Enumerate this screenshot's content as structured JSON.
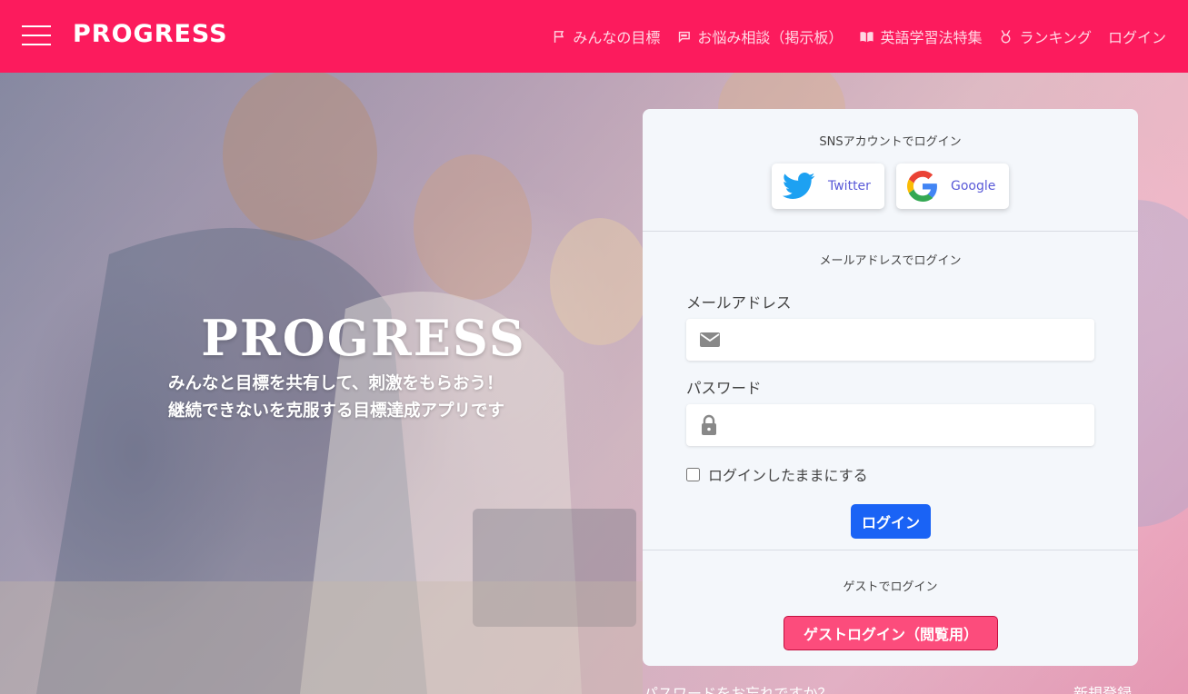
{
  "navbar": {
    "brand": "PROGRESS",
    "links": [
      {
        "label": "みんなの目標",
        "icon": "flag-icon"
      },
      {
        "label": "お悩み相談（掲示板）",
        "icon": "chat-icon"
      },
      {
        "label": "英語学習法特集",
        "icon": "book-icon"
      },
      {
        "label": "ランキング",
        "icon": "medal-icon"
      },
      {
        "label": "ログイン",
        "icon": ""
      }
    ],
    "color": "#fc1b5d"
  },
  "hero": {
    "title": "PROGRESS",
    "subtitle_line1": "みんなと目標を共有して、刺激をもらおう！",
    "subtitle_line2": "継続できないを克服する目標達成アプリです"
  },
  "login_card": {
    "sns_label": "SNSアカウントでログイン",
    "twitter_label": "Twitter",
    "google_label": "Google",
    "mail_label": "メールアドレスでログイン",
    "email_label": "メールアドレス",
    "email_value": "",
    "password_label": "パスワード",
    "password_value": "",
    "remember_label": "ログインしたままにする",
    "login_button": "ログイン",
    "guest_label": "ゲストでログイン",
    "guest_button": "ゲストログイン（閲覧用）"
  },
  "footer_links": {
    "forgot": "パスワードをお忘れですか？",
    "signup": "新規登録"
  },
  "colors": {
    "primary": "#fc1b5d",
    "login_button": "#1a63f5",
    "guest_button": "#fc4c7c",
    "twitter": "#1da1f2"
  }
}
